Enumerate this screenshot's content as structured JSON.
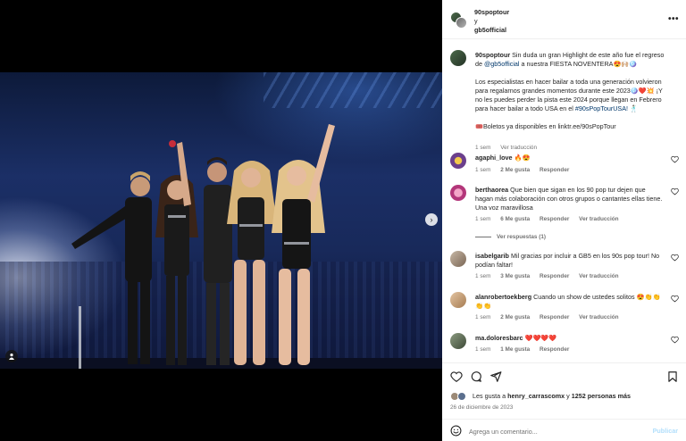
{
  "post": {
    "header_user": "90spoptour",
    "header_and": "y",
    "header_collab": "gb5official",
    "caption_user": "90spoptour",
    "caption_p1": "Sin duda un gran Highlight de este año fue el regreso de",
    "caption_mention": "@gb5official",
    "caption_p1b": "a nuestra FIESTA NOVENTERA😍🙌🏼🪩",
    "caption_p2": "Los especialistas en hacer bailar a toda una generación volvieron para regalarnos grandes momentos durante este 2023🪩❤️💥 ¡Y no les puedes perder la pista este 2024 porque llegan en Febrero para hacer bailar a todo USA en el",
    "caption_hashtag": "#90sPopTourUSA!",
    "caption_p2b": "🕺🏻",
    "caption_p3": "🎟️Boletos ya disponibles en linktr.ee/90sPopTour",
    "caption_time": "1 sem",
    "caption_translate": "Ver traducción"
  },
  "comments": [
    {
      "user": "agaphi_love",
      "text": "🔥😍",
      "time": "1 sem",
      "likes": "2 Me gusta",
      "reply": "Responder",
      "translate": "",
      "avatar_color": "#6b3f8c"
    },
    {
      "user": "berthaorea",
      "text": "Que bien que sigan en los 90 pop tur dejen que hagan más colaboración con otros grupos o cantantes ellas tiene. Una voz maravillosa",
      "time": "1 sem",
      "likes": "6 Me gusta",
      "reply": "Responder",
      "translate": "Ver traducción",
      "replies": "Ver respuestas (1)",
      "avatar_color": "#b3367a"
    },
    {
      "user": "isabelgarib",
      "text": "Mil gracias por incluir a GB5 en los 90s pop tour! No podían faltar!",
      "time": "1 sem",
      "likes": "3 Me gusta",
      "reply": "Responder",
      "translate": "Ver traducción",
      "avatar_color": "#9a8470"
    },
    {
      "user": "alanrobertoekberg",
      "text": "Cuando un show de ustedes solitos 😍👏👏👏👏",
      "time": "1 sem",
      "likes": "2 Me gusta",
      "reply": "Responder",
      "translate": "Ver traducción",
      "avatar_color": "#c49a6c"
    },
    {
      "user": "ma.doloresbarc",
      "text": "❤️❤️❤️❤️",
      "time": "1 sem",
      "likes": "1 Me gusta",
      "reply": "Responder",
      "translate": "",
      "avatar_color": "#5d6b55"
    }
  ],
  "footer": {
    "likes_prefix": "Les gusta a",
    "likes_user": "henry_carrascomx",
    "likes_and": "y",
    "likes_count": "1252 personas más",
    "date": "26 de diciembre de 2023",
    "comment_placeholder": "Agrega un comentario...",
    "publish_label": "Publicar"
  },
  "icons": {
    "next": "chevron-right-icon",
    "tag": "user-tag-icon",
    "more": "more-options-icon",
    "like": "heart-icon",
    "comment": "comment-icon",
    "share": "share-icon",
    "save": "bookmark-icon",
    "emoji": "emoji-icon"
  }
}
